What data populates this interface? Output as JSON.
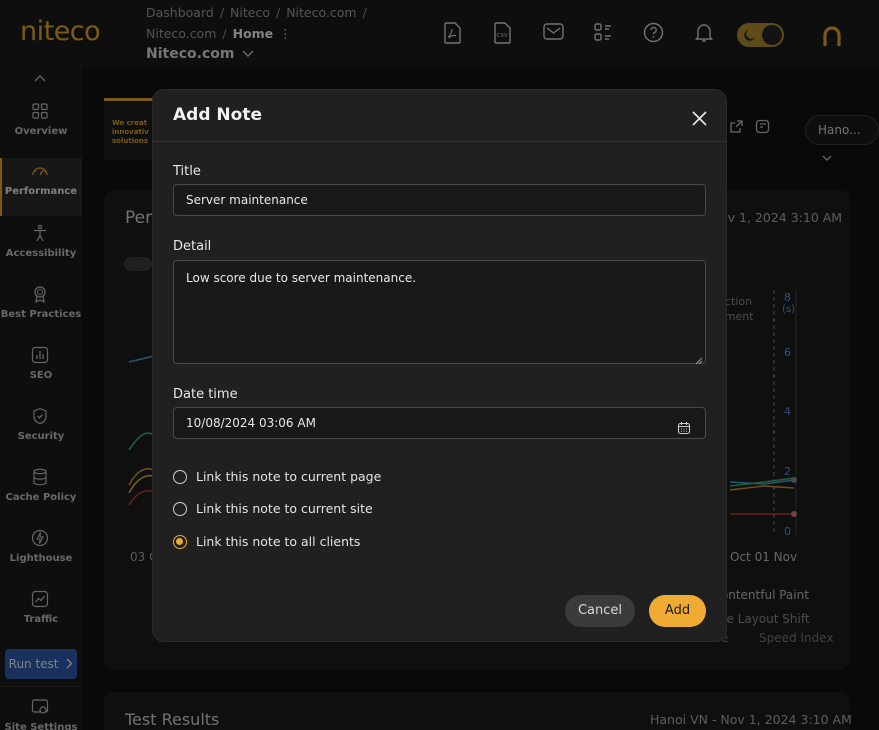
{
  "header": {
    "logo": "niteco",
    "breadcrumb": [
      "Dashboard",
      "Niteco",
      "Niteco.com",
      "Niteco.com"
    ],
    "breadcrumb_current": "Home",
    "breadcrumb_more": "⋮",
    "site_select": "Niteco.com",
    "icons": [
      "pdf-export-icon",
      "csv-export-icon",
      "mail-icon",
      "apps-icon",
      "help-icon",
      "bell-icon"
    ],
    "theme_toggle": "dark",
    "avatar_letter": "n"
  },
  "sidebar": {
    "items": [
      {
        "label": "Overview",
        "icon": "grid-icon"
      },
      {
        "label": "Performance",
        "icon": "speedometer-icon",
        "active": true
      },
      {
        "label": "Accessibility",
        "icon": "accessibility-icon"
      },
      {
        "label": "Best Practices",
        "icon": "award-icon"
      },
      {
        "label": "SEO",
        "icon": "bar-chart-icon"
      },
      {
        "label": "Security",
        "icon": "shield-icon"
      },
      {
        "label": "Cache Policy",
        "icon": "database-icon"
      },
      {
        "label": "Lighthouse",
        "icon": "lighthouse-icon"
      },
      {
        "label": "Traffic",
        "icon": "traffic-icon"
      }
    ],
    "run_test": "Run test",
    "site_settings": "Site Settings"
  },
  "background": {
    "thumb_lines": [
      "We creat",
      "innovativ",
      "solutions"
    ],
    "card_title": "Per",
    "card_timestamp": "ov 1, 2024 3:10 AM",
    "location_select": "Hano...",
    "chart_axis_right": [
      "8",
      "(s)",
      "6",
      "4",
      "2",
      "0"
    ],
    "chart_x_labels": [
      "03 C",
      "Oct 01 Nov"
    ],
    "chart_fragments": [
      "uction",
      "oment"
    ],
    "legend": [
      "t Contentful Paint",
      "ative Layout Shift",
      "Time To Interactive",
      "Speed Index"
    ],
    "test_results_title": "Test Results",
    "test_results_meta": "Hanoi VN - Nov 1, 2024 3:10 AM"
  },
  "modal": {
    "title": "Add Note",
    "title_label": "Title",
    "title_value": "Server maintenance",
    "detail_label": "Detail",
    "detail_value": "Low score due to server maintenance.",
    "datetime_label": "Date time",
    "datetime_value": "10/08/2024 03:06 AM",
    "options": [
      {
        "label": "Link this note to current page",
        "checked": false
      },
      {
        "label": "Link this note to current site",
        "checked": false
      },
      {
        "label": "Link this note to all clients",
        "checked": true
      }
    ],
    "cancel": "Cancel",
    "add": "Add"
  },
  "colors": {
    "accent": "#f0ab34",
    "run_test": "#2f5aa8",
    "background": "#121212",
    "modal": "#202020"
  }
}
